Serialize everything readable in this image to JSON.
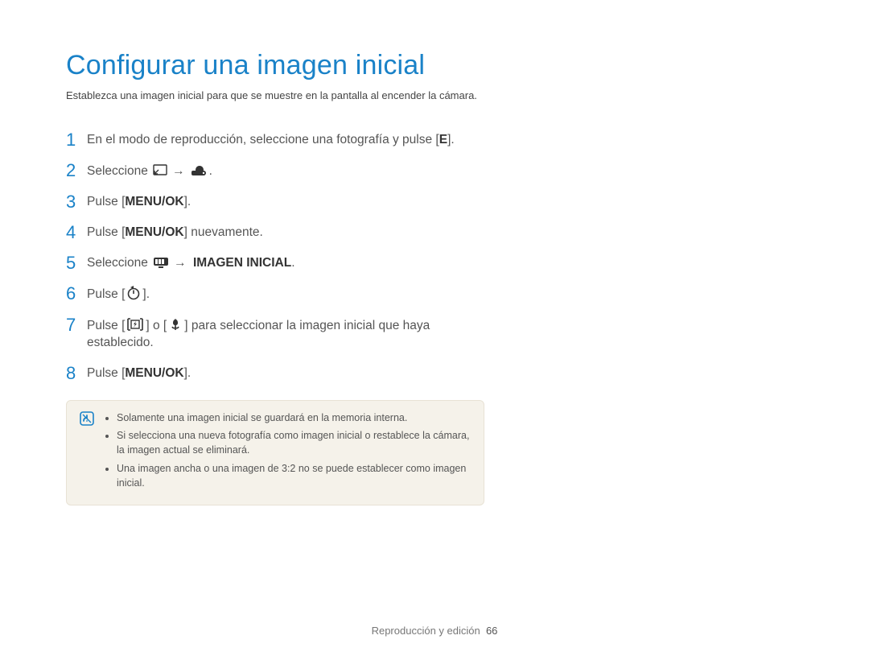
{
  "title": "Configurar una imagen inicial",
  "intro": "Establezca una imagen inicial para que se muestre en la pantalla al encender la cámara.",
  "steps": [
    {
      "num": "1",
      "parts": [
        {
          "t": "text",
          "v": "En el modo de reproducción, seleccione una fotografía y pulse ["
        },
        {
          "t": "bold",
          "v": "E"
        },
        {
          "t": "text",
          "v": "]."
        }
      ]
    },
    {
      "num": "2",
      "parts": [
        {
          "t": "text",
          "v": "Seleccione "
        },
        {
          "t": "icon",
          "v": "resize-icon"
        },
        {
          "t": "arrow",
          "v": "→"
        },
        {
          "t": "icon",
          "v": "startimage-icon"
        },
        {
          "t": "text",
          "v": "."
        }
      ]
    },
    {
      "num": "3",
      "parts": [
        {
          "t": "text",
          "v": "Pulse ["
        },
        {
          "t": "bold",
          "v": "MENU/OK"
        },
        {
          "t": "text",
          "v": "]."
        }
      ]
    },
    {
      "num": "4",
      "parts": [
        {
          "t": "text",
          "v": "Pulse ["
        },
        {
          "t": "bold",
          "v": "MENU/OK"
        },
        {
          "t": "text",
          "v": "] nuevamente."
        }
      ]
    },
    {
      "num": "5",
      "parts": [
        {
          "t": "text",
          "v": "Seleccione "
        },
        {
          "t": "icon",
          "v": "display-icon"
        },
        {
          "t": "arrow",
          "v": "→"
        },
        {
          "t": "bold",
          "v": " IMAGEN INICIAL"
        },
        {
          "t": "text",
          "v": "."
        }
      ]
    },
    {
      "num": "6",
      "parts": [
        {
          "t": "text",
          "v": "Pulse ["
        },
        {
          "t": "icon",
          "v": "timer-icon"
        },
        {
          "t": "text",
          "v": "]."
        }
      ]
    },
    {
      "num": "7",
      "parts": [
        {
          "t": "text",
          "v": "Pulse ["
        },
        {
          "t": "icon",
          "v": "flash-icon"
        },
        {
          "t": "text",
          "v": "] o ["
        },
        {
          "t": "icon",
          "v": "macro-icon"
        },
        {
          "t": "text",
          "v": "] para seleccionar la imagen inicial que haya establecido."
        }
      ]
    },
    {
      "num": "8",
      "parts": [
        {
          "t": "text",
          "v": "Pulse ["
        },
        {
          "t": "bold",
          "v": "MENU/OK"
        },
        {
          "t": "text",
          "v": "]."
        }
      ]
    }
  ],
  "notes": [
    "Solamente una imagen inicial se guardará en la memoria interna.",
    "Si selecciona una nueva fotografía como imagen inicial o restablece la cámara, la imagen actual se eliminará.",
    "Una imagen ancha o una imagen de 3:2 no se puede establecer como imagen inicial."
  ],
  "footer_section": "Reproducción y edición",
  "footer_page": "66",
  "icons": {
    "resize-icon": "resize",
    "startimage-icon": "startimage",
    "display-icon": "display",
    "timer-icon": "timer",
    "flash-icon": "flash",
    "macro-icon": "macro",
    "note-icon": "note"
  }
}
